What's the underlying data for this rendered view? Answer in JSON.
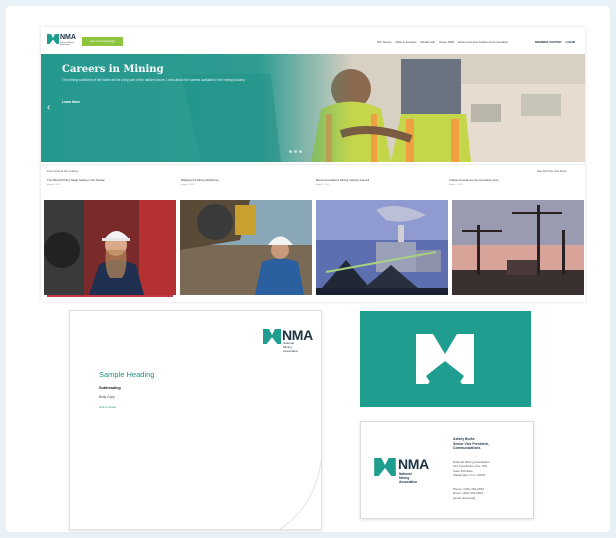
{
  "colors": {
    "teal": "#1f9e8f",
    "navy": "#1d3346",
    "green": "#8dc53f",
    "accent_red": "#c23a44"
  },
  "website": {
    "logo_text": "NMA",
    "logo_subtext": "National Mining Association",
    "cta_label": "Join the Campaign",
    "nav": [
      "Our Issues",
      "Data & Analysis",
      "Media Hub",
      "About NMA",
      "Environmental Justice and Innovation"
    ],
    "util_nav": [
      "MEMBER CENTER",
      "LOGIN"
    ],
    "hero": {
      "title": "Careers in Mining",
      "body": "The mining workforce of the future will be a key part of the nation's future. Learn about the careers available in the mining industry.",
      "link": "Learn More",
      "prev_icon": "‹"
    },
    "news": {
      "heading": "From Around the Industry",
      "view_all": "See All Posts and Press",
      "items": [
        {
          "title": "The Mineral Policy Stage Setting in the Senate",
          "date": "August 5, 2022"
        },
        {
          "title": "Mapping the Mining Workforce",
          "date": "August 3, 2022"
        },
        {
          "title": "Recommendations Mining Industry Council",
          "date": "August 2, 2022"
        },
        {
          "title": "Critical minerals are the innovation story",
          "date": "August 1, 2022"
        }
      ]
    }
  },
  "letterhead": {
    "logo_text": "NMA",
    "logo_subtext": [
      "National",
      "Mining",
      "Association"
    ],
    "heading": "Sample Heading",
    "subheading": "Subheading",
    "body": "Body Copy",
    "link": "Link to footer"
  },
  "business_card": {
    "logo_text": "NMA",
    "logo_subtext": [
      "National",
      "Mining",
      "Association"
    ],
    "name_lines": [
      "Ashley Burke",
      "Senior Vice President,",
      "Communications"
    ],
    "address_lines": [
      "National Mining Association",
      "101 Constitution Ave, NW",
      "Suite 500 East",
      "Washington, D.C. 20001"
    ],
    "contact_lines": [
      "Phone: (202) 463-2600",
      "Direct: (202) 463-2604",
      "[email protected]"
    ]
  }
}
